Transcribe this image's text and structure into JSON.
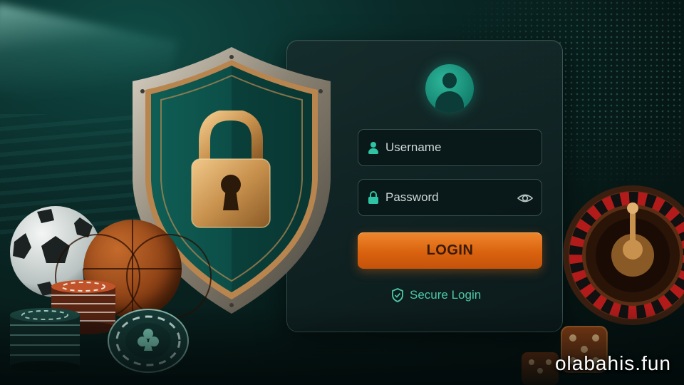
{
  "login_form": {
    "username_placeholder": "Username",
    "password_placeholder": "Password",
    "login_label": "LOGIN",
    "secure_label": "Secure Login"
  },
  "watermark": "olabahis.fun",
  "colors": {
    "accent_teal": "#2fc5a4",
    "button_orange": "#e0711c",
    "card_bg": "#112224",
    "shield_gold": "#b98a52"
  },
  "icons": {
    "avatar": "user-avatar-icon",
    "username": "user-icon",
    "password": "lock-icon",
    "reveal": "eye-icon",
    "secure": "shield-check-icon",
    "chip": "club-icon"
  }
}
